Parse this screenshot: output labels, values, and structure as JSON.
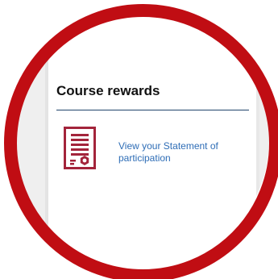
{
  "panel": {
    "heading": "Course rewards",
    "reward_link": "View your Statement of participation",
    "reward_icon": "certificate-icon"
  },
  "colors": {
    "ring": "#c00d13",
    "icon": "#a3243b",
    "link": "#2e6db6",
    "divider": "#21446b"
  }
}
